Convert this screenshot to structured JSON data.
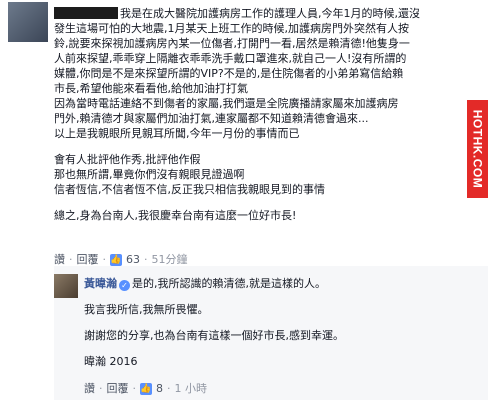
{
  "comment": {
    "lines": [
      "我是在成大醫院加護病房工作的護理人員,今年1月的時候,還沒",
      "發生這場可怕的大地震,1月某天上班工作的時候,加護病房門外突然有人按",
      "鈴,說要來探視加護病房內某一位傷者,打開門一看,居然是賴清德!他隻身一",
      "人前來探望,乖乖穿上隔離衣乖乖洗手戴口罩進來,就自己一人!沒有所謂的",
      "媒體,你問是不是來探望所謂的VIP?不是的,是住院傷者的小弟弟寫信給賴",
      "市長,希望他能來看看他,給他加油打打氣",
      "因為當時電話連絡不到傷者的家屬,我們還是全院廣播請家屬來加護病房",
      "門外,賴清德才與家屬們加油打氣,連家屬都不知道賴清德會過來...",
      "以上是我親眼所見親耳所聞,今年一月份的事情而已"
    ],
    "lines2": [
      "會有人批評他作秀,批評他作假",
      "那也無所謂,畢竟你們沒有親眼見證過啊",
      "信者恆信,不信者恆不信,反正我只相信我親眼見到的事情"
    ],
    "closing": "總之,身為台南人,我很慶幸台南有這麼一位好市長!",
    "actions": {
      "like": "讚",
      "reply": "回覆",
      "like_count": "63",
      "time": "51分鐘"
    }
  },
  "reply": {
    "name": "黃暐瀚",
    "lines": [
      "是的,我所認識的賴清德,就是這樣的人。",
      "我言我所信,我無所畏懼。",
      "謝謝您的分享,也為台南有這樣一個好市長,感到幸運。",
      "暐瀚 2016"
    ],
    "actions": {
      "like": "讚",
      "reply": "回覆",
      "like_count": "8",
      "time": "1 小時"
    }
  },
  "watermark": "HOTHK.COM",
  "colors": {
    "link": "#3b5998",
    "meta": "#9197a3",
    "like_badge": "#5890ff",
    "watermark_bg": "#e32a28"
  }
}
